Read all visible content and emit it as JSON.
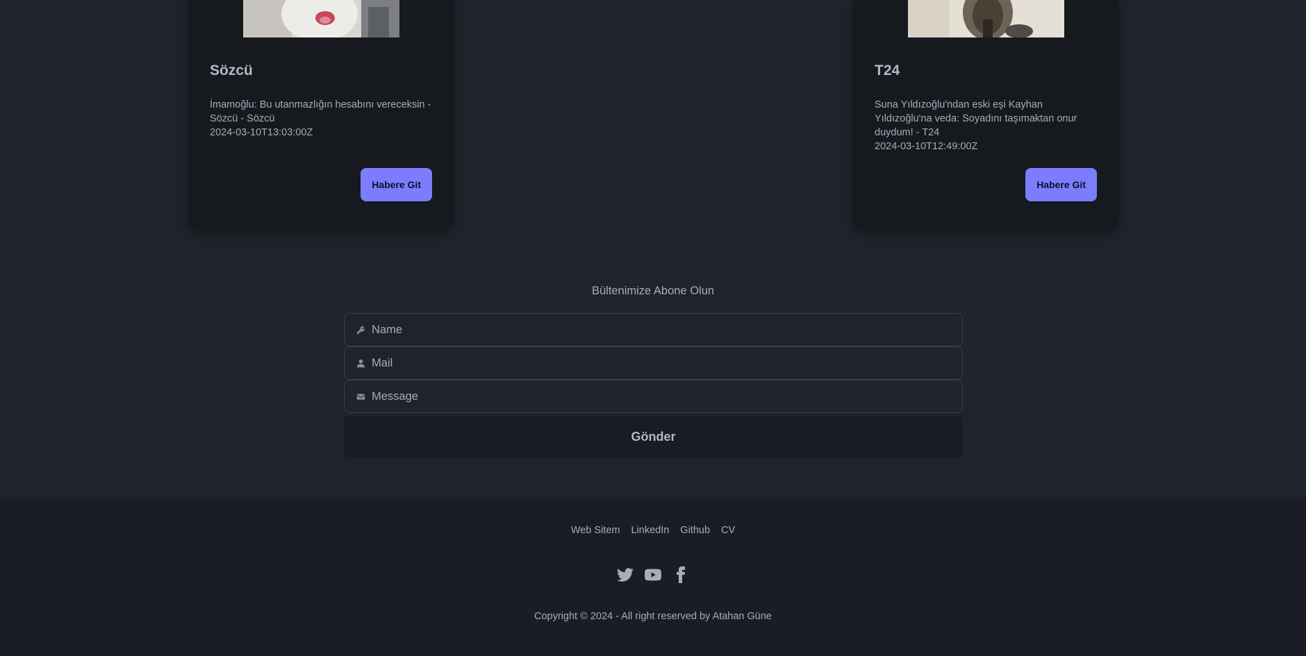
{
  "cards": [
    {
      "title": "Sözcü",
      "description": "İmamoğlu: Bu utanmazlığın hesabını vereceksin - Sözcü - Sözcü",
      "date": "2024-03-10T13:03:00Z",
      "button_label": "Habere Git"
    },
    {
      "title": "T24",
      "description": "Suna Yıldızoğlu'ndan eski eşi Kayhan Yıldızoğlu'na veda: Soyadını taşımaktan onur duydum! - T24",
      "date": "2024-03-10T12:49:00Z",
      "button_label": "Habere Git"
    }
  ],
  "newsletter": {
    "title": "Bültenimize Abone Olun",
    "name_placeholder": "Name",
    "mail_placeholder": "Mail",
    "message_placeholder": "Message",
    "submit_label": "Gönder"
  },
  "footer": {
    "links": [
      "Web Sitem",
      "LinkedIn",
      "Github",
      "CV"
    ],
    "social_icons": [
      "twitter-icon",
      "youtube-icon",
      "facebook-icon"
    ],
    "copyright": "Copyright © 2024 - All right reserved by Atahan Güne"
  },
  "colors": {
    "background": "#1f232b",
    "card": "#16191e",
    "accent_button": "#7b7dfd",
    "footer": "#1a1d23"
  }
}
